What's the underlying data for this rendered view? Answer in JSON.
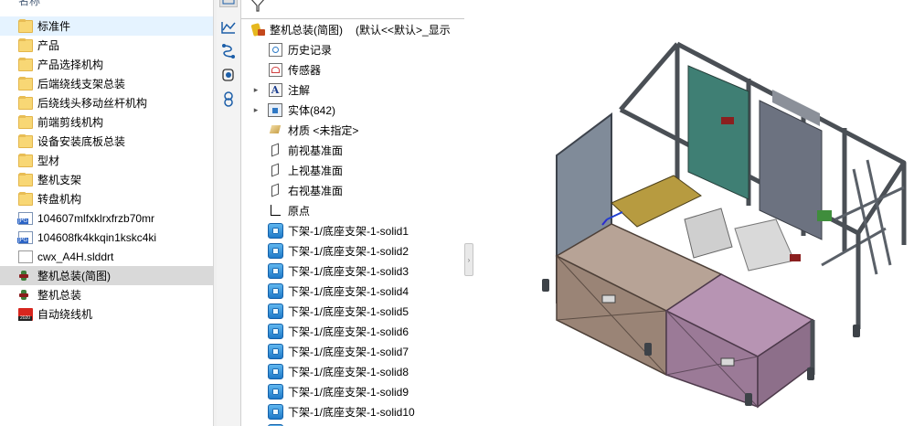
{
  "explorer": {
    "column_header": "名称",
    "items": [
      {
        "label": "标准件",
        "icon": "folder-icon"
      },
      {
        "label": "产品",
        "icon": "folder-icon"
      },
      {
        "label": "产品选择机构",
        "icon": "folder-icon"
      },
      {
        "label": "后端绕线支架总装",
        "icon": "folder-icon"
      },
      {
        "label": "后绕线头移动丝杆机构",
        "icon": "folder-icon"
      },
      {
        "label": "前端剪线机构",
        "icon": "folder-icon"
      },
      {
        "label": "设备安装底板总装",
        "icon": "folder-icon"
      },
      {
        "label": "型材",
        "icon": "folder-icon"
      },
      {
        "label": "整机支架",
        "icon": "folder-icon"
      },
      {
        "label": "转盘机构",
        "icon": "folder-icon"
      },
      {
        "label": "104607mlfxklrxfrzb70mr",
        "icon": "jpg-file-icon"
      },
      {
        "label": "104608fk4kkqin1kskc4ki",
        "icon": "jpg-file-icon"
      },
      {
        "label": "cwx_A4H.slddrt",
        "icon": "file-icon"
      },
      {
        "label": "整机总装(简图)",
        "icon": "assembly-icon"
      },
      {
        "label": "整机总装",
        "icon": "assembly-icon"
      },
      {
        "label": "自动绕线机",
        "icon": "solidworks-app-icon"
      }
    ]
  },
  "tree": {
    "root": {
      "label": "整机总装(简图)",
      "config": "(默认<<默认>_显示"
    },
    "nodes": [
      {
        "label": "历史记录",
        "icon": "history-icon",
        "expander": ""
      },
      {
        "label": "传感器",
        "icon": "sensor-icon",
        "expander": ""
      },
      {
        "label": "注解",
        "icon": "annotation-icon",
        "expander": "▸"
      },
      {
        "label": "实体(842)",
        "icon": "solid-bodies-icon",
        "expander": "▸"
      },
      {
        "label": "材质 <未指定>",
        "icon": "material-icon",
        "expander": ""
      },
      {
        "label": "前视基准面",
        "icon": "plane-icon",
        "expander": ""
      },
      {
        "label": "上视基准面",
        "icon": "plane-icon",
        "expander": ""
      },
      {
        "label": "右视基准面",
        "icon": "plane-icon",
        "expander": ""
      },
      {
        "label": "原点",
        "icon": "origin-icon",
        "expander": ""
      },
      {
        "label": "下架-1/底座支架-1-solid1",
        "icon": "body-icon",
        "expander": ""
      },
      {
        "label": "下架-1/底座支架-1-solid2",
        "icon": "body-icon",
        "expander": ""
      },
      {
        "label": "下架-1/底座支架-1-solid3",
        "icon": "body-icon",
        "expander": ""
      },
      {
        "label": "下架-1/底座支架-1-solid4",
        "icon": "body-icon",
        "expander": ""
      },
      {
        "label": "下架-1/底座支架-1-solid5",
        "icon": "body-icon",
        "expander": ""
      },
      {
        "label": "下架-1/底座支架-1-solid6",
        "icon": "body-icon",
        "expander": ""
      },
      {
        "label": "下架-1/底座支架-1-solid7",
        "icon": "body-icon",
        "expander": ""
      },
      {
        "label": "下架-1/底座支架-1-solid8",
        "icon": "body-icon",
        "expander": ""
      },
      {
        "label": "下架-1/底座支架-1-solid9",
        "icon": "body-icon",
        "expander": ""
      },
      {
        "label": "下架-1/底座支架-1-solid10",
        "icon": "body-icon",
        "expander": ""
      }
    ]
  },
  "toolbar": {
    "icons": [
      "feature-manager-icon",
      "property-manager-icon",
      "configuration-manager-icon",
      "dimxpert-icon",
      "display-manager-icon"
    ]
  },
  "colors": {
    "selected_light": "#e5f3ff",
    "selected_grey": "#d9d9d9",
    "frame": "#4a4f55",
    "panel_teal": "#3f7f74",
    "base_left": "#9a8476",
    "base_right": "#9b7a97"
  }
}
